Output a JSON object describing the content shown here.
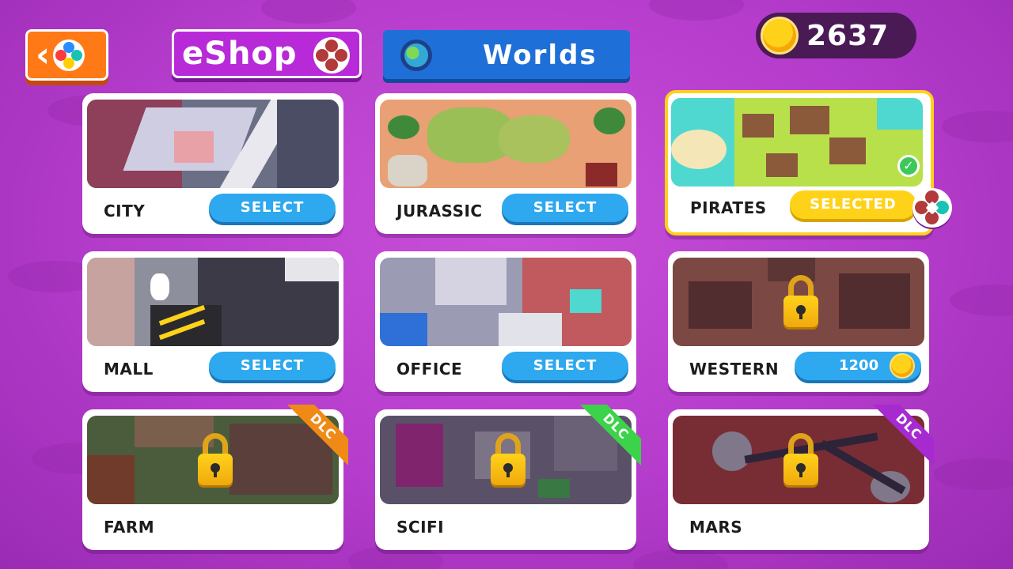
{
  "header": {
    "eshop_label": "eShop",
    "worlds_label": "Worlds",
    "coins": "2637"
  },
  "colors": {
    "background": "#b53ccc",
    "select_button": "#2ea8ee",
    "selected_button": "#ffd21a",
    "coin": "#ffd21a"
  },
  "worlds": [
    {
      "name": "CITY",
      "button": "SELECT",
      "state": "unlocked"
    },
    {
      "name": "JURASSIC",
      "button": "SELECT",
      "state": "unlocked"
    },
    {
      "name": "PIRATES",
      "button": "SELECTED",
      "state": "selected"
    },
    {
      "name": "MALL",
      "button": "SELECT",
      "state": "unlocked"
    },
    {
      "name": "OFFICE",
      "button": "SELECT",
      "state": "unlocked"
    },
    {
      "name": "WESTERN",
      "price": "1200",
      "state": "locked"
    },
    {
      "name": "FARM",
      "dlc": "DLC",
      "dlc_color": "#f08a16",
      "state": "locked-dlc"
    },
    {
      "name": "SCIFI",
      "dlc": "DLC",
      "dlc_color": "#3cd24a",
      "state": "locked-dlc"
    },
    {
      "name": "MARS",
      "dlc": "DLC",
      "dlc_color": "#a62ad0",
      "state": "locked-dlc"
    }
  ]
}
